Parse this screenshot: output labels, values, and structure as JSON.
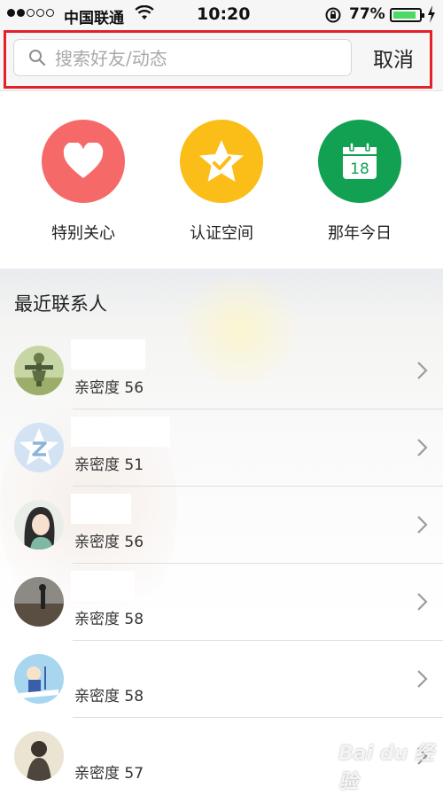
{
  "status_bar": {
    "signal_dots": "●●○○○",
    "carrier": "中国联通",
    "time": "10:20",
    "battery_percent": "77%",
    "battery_level": 0.77
  },
  "search": {
    "placeholder": "搜索好友/动态",
    "value": "",
    "cancel_label": "取消",
    "highlight_color": "#e2212b"
  },
  "quick_entries": [
    {
      "label": "特别关心",
      "icon": "heart-icon",
      "color": "#f56a69"
    },
    {
      "label": "认证空间",
      "icon": "star-check-icon",
      "color": "#fbbd17"
    },
    {
      "label": "那年今日",
      "icon": "calendar-icon",
      "color": "#12a153",
      "icon_text": "18"
    }
  ],
  "recent": {
    "title": "最近联系人",
    "contacts": [
      {
        "intimacy": "亲密度 56",
        "avatar": "scarecrow-avatar"
      },
      {
        "intimacy": "亲密度 51",
        "avatar": "qzone-star-avatar"
      },
      {
        "intimacy": "亲密度 56",
        "avatar": "anime-girl-avatar"
      },
      {
        "intimacy": "亲密度 58",
        "avatar": "beach-silhouette-avatar"
      },
      {
        "intimacy": "亲密度 58",
        "avatar": "cartoon-kid-avatar"
      },
      {
        "intimacy": "亲密度 57",
        "avatar": "ink-figure-avatar"
      }
    ]
  },
  "watermark": "Bai du 经验"
}
